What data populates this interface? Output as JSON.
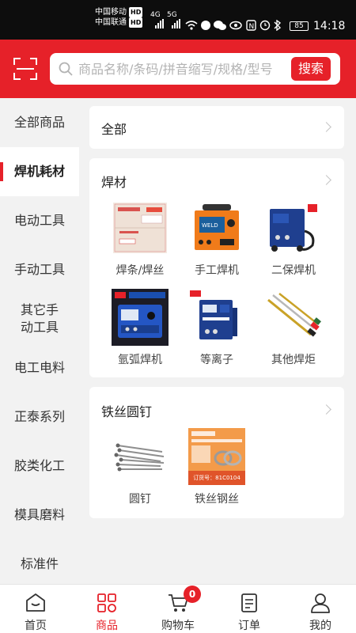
{
  "status_bar": {
    "carrier_1": "中国移动",
    "carrier_2": "中国联通",
    "hd": "HD",
    "sig_1": "4G",
    "sig_2": "5G",
    "battery": "85",
    "time": "14:18"
  },
  "header": {
    "search_placeholder": "商品名称/条码/拼音缩写/规格/型号",
    "search_button": "搜索"
  },
  "sidebar": {
    "active_index": 1,
    "items": [
      {
        "label": "全部商品"
      },
      {
        "label": "焊机耗材"
      },
      {
        "label": "电动工具"
      },
      {
        "label": "手动工具"
      },
      {
        "label": "其它手动工具"
      },
      {
        "label": "电工电料"
      },
      {
        "label": "正泰系列"
      },
      {
        "label": "胶类化工"
      },
      {
        "label": "模具磨料"
      },
      {
        "label": "标准件"
      }
    ]
  },
  "content": {
    "all_card": {
      "title": "全部"
    },
    "sections": [
      {
        "title": "焊材",
        "products": [
          {
            "label": "焊条/焊丝",
            "icon": "welding-rod-box-image"
          },
          {
            "label": "手工焊机",
            "icon": "manual-welder-image"
          },
          {
            "label": "二保焊机",
            "icon": "co2-welder-image"
          },
          {
            "label": "氩弧焊机",
            "icon": "argon-arc-welder-image"
          },
          {
            "label": "等离子",
            "icon": "plasma-cutter-image"
          },
          {
            "label": "其他焊炬",
            "icon": "welding-torch-image"
          }
        ]
      },
      {
        "title": "铁丝圆钉",
        "products": [
          {
            "label": "圆钉",
            "icon": "round-nails-image"
          },
          {
            "label": "铁丝钢丝",
            "icon": "steel-wire-image",
            "box_text": "订货号：81C0104"
          }
        ]
      }
    ]
  },
  "bottom_nav": {
    "active_index": 1,
    "cart_badge": "0",
    "tabs": [
      {
        "label": "首页",
        "icon": "home-icon"
      },
      {
        "label": "商品",
        "icon": "products-grid-icon"
      },
      {
        "label": "购物车",
        "icon": "cart-icon"
      },
      {
        "label": "订单",
        "icon": "orders-icon"
      },
      {
        "label": "我的",
        "icon": "profile-icon"
      }
    ]
  },
  "colors": {
    "brand_red": "#e62129",
    "background": "#f2f2f2"
  }
}
